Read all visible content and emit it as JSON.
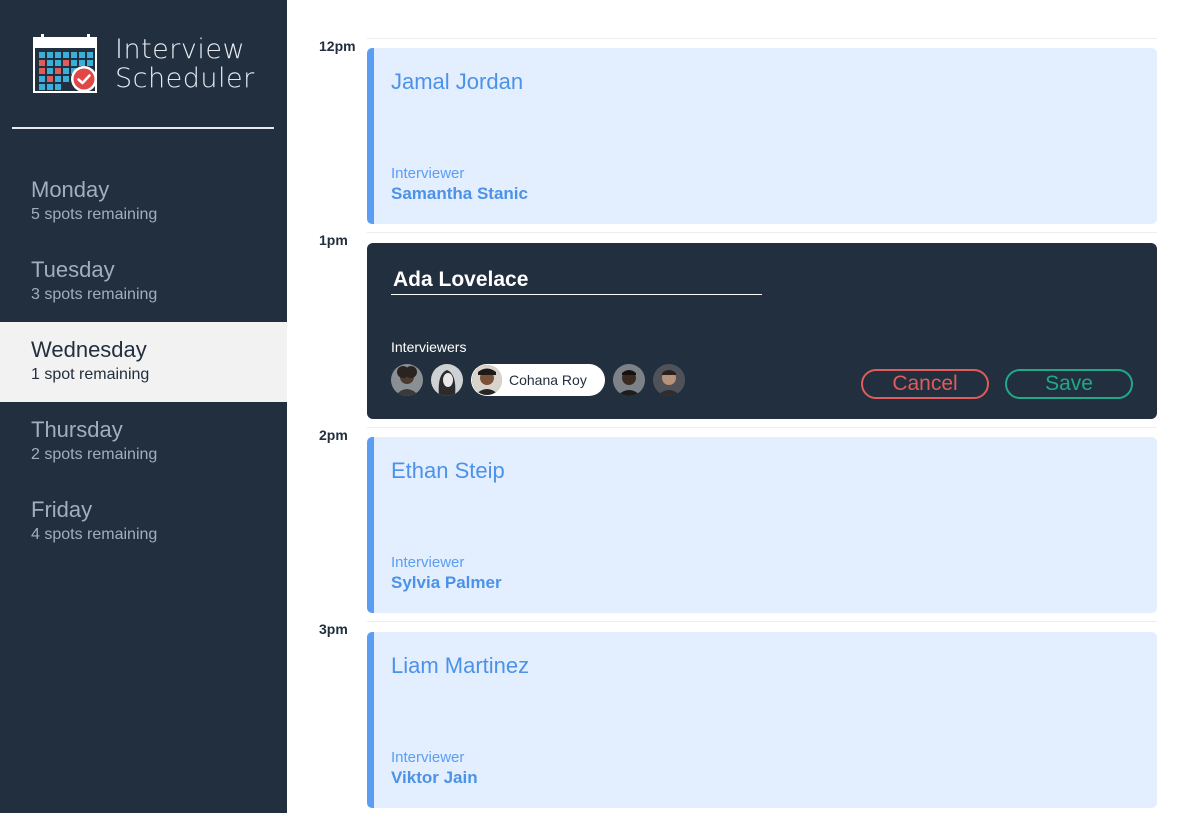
{
  "app": {
    "title_line1": "Interview",
    "title_line2": "Scheduler",
    "logo_icon": "calendar-check-icon"
  },
  "days": [
    {
      "name": "Monday",
      "spots": "5 spots remaining",
      "selected": false
    },
    {
      "name": "Tuesday",
      "spots": "3 spots remaining",
      "selected": false
    },
    {
      "name": "Wednesday",
      "spots": "1 spot remaining",
      "selected": true
    },
    {
      "name": "Thursday",
      "spots": "2 spots remaining",
      "selected": false
    },
    {
      "name": "Friday",
      "spots": "4 spots remaining",
      "selected": false
    }
  ],
  "slots": [
    {
      "time": "12pm",
      "student": "Jamal Jordan",
      "interviewer_label": "Interviewer",
      "interviewer": "Samantha Stanic"
    },
    {
      "time": "1pm"
    },
    {
      "time": "2pm",
      "student": "Ethan Steip",
      "interviewer_label": "Interviewer",
      "interviewer": "Sylvia Palmer"
    },
    {
      "time": "3pm",
      "student": "Liam Martinez",
      "interviewer_label": "Interviewer",
      "interviewer": "Viktor Jain"
    }
  ],
  "form": {
    "student_value": "Ada Lovelace",
    "interviewers_label": "Interviewers",
    "selected_interviewer": "Cohana Roy",
    "cancel_label": "Cancel",
    "save_label": "Save"
  },
  "colors": {
    "sidebar_bg": "#222f3e",
    "appointment_bg": "#e3efff",
    "accent_blue": "#5a9df2",
    "cancel": "#e05b5b",
    "save": "#22a887"
  }
}
